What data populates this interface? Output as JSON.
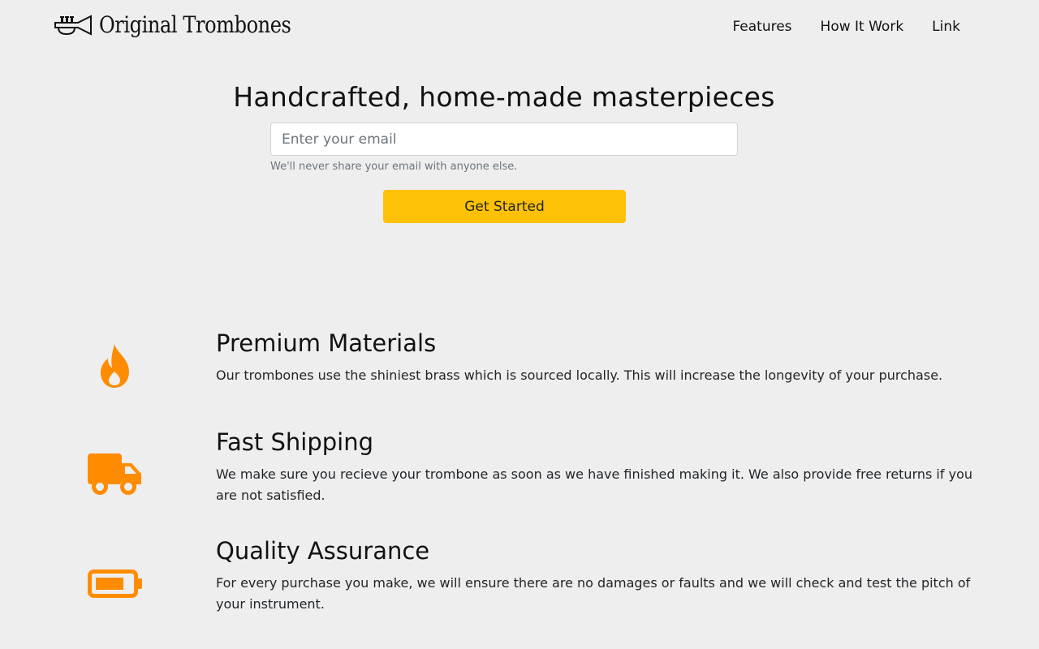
{
  "header": {
    "brand": "Original Trombones",
    "logo_icon": "trumpet-icon",
    "nav": [
      {
        "label": "Features"
      },
      {
        "label": "How It Work"
      },
      {
        "label": "Link"
      }
    ]
  },
  "hero": {
    "title": "Handcrafted, home-made masterpieces",
    "email_placeholder": "Enter your email",
    "email_value": "",
    "email_help": "We'll never share your email with anyone else.",
    "cta_label": "Get Started",
    "cta_color": "#ffc107"
  },
  "features": {
    "accent_color": "#ff8c00",
    "items": [
      {
        "icon": "fire-icon",
        "title": "Premium Materials",
        "description": "Our trombones use the shiniest brass which is sourced locally. This will increase the longevity of your purchase."
      },
      {
        "icon": "truck-icon",
        "title": "Fast Shipping",
        "description": "We make sure you recieve your trombone as soon as we have finished making it. We also provide free returns if you are not satisfied."
      },
      {
        "icon": "battery-icon",
        "title": "Quality Assurance",
        "description": "For every purchase you make, we will ensure there are no damages or faults and we will check and test the pitch of your instrument."
      }
    ]
  }
}
